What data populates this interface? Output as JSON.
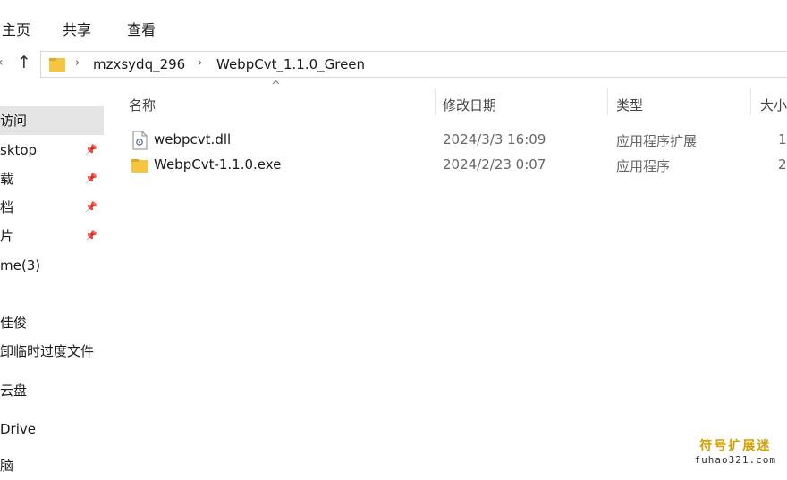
{
  "window": {
    "title_fragment": "¯ ¯ ¯ ¯ ¯ ¯ ¯"
  },
  "ribbon": {
    "tabs": [
      "主页",
      "共享",
      "查看"
    ]
  },
  "address": {
    "back_glyph": "‹",
    "up_glyph": "↑",
    "separator": "›",
    "segments": [
      "mzxsydq_296",
      "WebpCvt_1.1.0_Green"
    ]
  },
  "nav": {
    "items": [
      {
        "label": "访问",
        "pinned": false,
        "selected": true
      },
      {
        "label": "sktop",
        "pinned": true,
        "selected": false
      },
      {
        "label": "载",
        "pinned": true,
        "selected": false
      },
      {
        "label": "档",
        "pinned": true,
        "selected": false
      },
      {
        "label": "片",
        "pinned": true,
        "selected": false
      },
      {
        "label": "me(3)",
        "pinned": false,
        "selected": false
      },
      {
        "label": "佳俊",
        "pinned": false,
        "selected": false
      },
      {
        "label": "卸临时过度文件",
        "pinned": false,
        "selected": false
      },
      {
        "label": "云盘",
        "pinned": false,
        "selected": false
      },
      {
        "label": "Drive",
        "pinned": false,
        "selected": false
      },
      {
        "label": "脑",
        "pinned": false,
        "selected": false
      }
    ],
    "pin_glyph": "📌"
  },
  "columns": {
    "name": "名称",
    "date": "修改日期",
    "type": "类型",
    "size": "大小"
  },
  "sort_caret": "^",
  "files": [
    {
      "name": "webpcvt.dll",
      "date": "2024/3/3 16:09",
      "type": "应用程序扩展",
      "size": "1",
      "icon": "dll-file-icon"
    },
    {
      "name": "WebpCvt-1.1.0.exe",
      "date": "2024/2/23 0:07",
      "type": "应用程序",
      "size": "2",
      "icon": "folder-icon"
    }
  ],
  "watermark": {
    "line1": "符号扩展迷",
    "line2": "fuhao321.com"
  },
  "colors": {
    "selected_bg": "#e5e5e5",
    "folder": "#f5c542",
    "watermark": "#d4a000"
  }
}
